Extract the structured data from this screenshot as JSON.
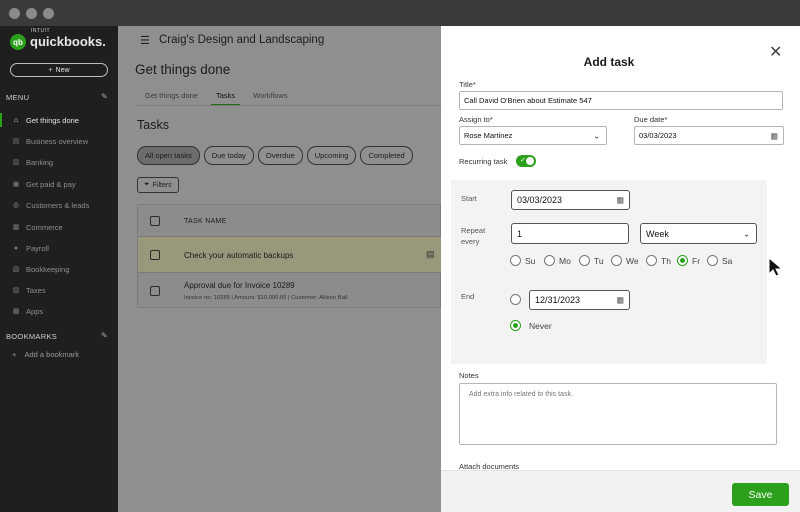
{
  "sidebar": {
    "logo_intuit": "INTUIT",
    "logo_text": "quickbooks.",
    "logo_mark": "qb",
    "new_label": "New",
    "menu_heading": "MENU",
    "items": [
      {
        "label": "Get things done",
        "icon": "house-icon"
      },
      {
        "label": "Business overview",
        "icon": "chart-icon"
      },
      {
        "label": "Banking",
        "icon": "bank-icon"
      },
      {
        "label": "Get paid & pay",
        "icon": "cash-icon"
      },
      {
        "label": "Customers & leads",
        "icon": "people-icon"
      },
      {
        "label": "Commerce",
        "icon": "cart-icon"
      },
      {
        "label": "Payroll",
        "icon": "person-icon"
      },
      {
        "label": "Bookkeeping",
        "icon": "ledger-icon"
      },
      {
        "label": "Taxes",
        "icon": "tax-icon"
      },
      {
        "label": "Apps",
        "icon": "apps-icon"
      }
    ],
    "bookmarks_heading": "BOOKMARKS",
    "add_bookmark": "Add a bookmark"
  },
  "main": {
    "company": "Craig's Design and Landscaping",
    "page_title": "Get things done",
    "tabs": [
      {
        "label": "Get things done"
      },
      {
        "label": "Tasks"
      },
      {
        "label": "Workflows"
      }
    ],
    "tasks_title": "Tasks",
    "chips": [
      {
        "label": "All open tasks"
      },
      {
        "label": "Due today"
      },
      {
        "label": "Overdue"
      },
      {
        "label": "Upcoming"
      },
      {
        "label": "Completed"
      }
    ],
    "filters_label": "Filters",
    "table": {
      "header": "TASK NAME",
      "rows": [
        {
          "title": "Check your automatic backups",
          "sub": ""
        },
        {
          "title": "Approval due for Invoice 10289",
          "sub": "Invoice no: 10289 | Amount: $10,000.00 | Customer: Allison Ball"
        }
      ]
    }
  },
  "drawer": {
    "title": "Add task",
    "title_label": "Title*",
    "title_value": "Call David O'Brien about Estimate 547",
    "assign_label": "Assign to*",
    "assign_value": "Rose Martinez",
    "due_label": "Due date*",
    "due_value": "03/03/2023",
    "recurring_label": "Recurring task",
    "recurring_on": true,
    "start_label": "Start",
    "start_value": "03/03/2023",
    "repeat_label_1": "Repeat",
    "repeat_label_2": "every",
    "repeat_value": "1",
    "repeat_unit": "Week",
    "days": [
      {
        "label": "Su",
        "selected": false
      },
      {
        "label": "Mo",
        "selected": false
      },
      {
        "label": "Tu",
        "selected": false
      },
      {
        "label": "We",
        "selected": false
      },
      {
        "label": "Th",
        "selected": false
      },
      {
        "label": "Fr",
        "selected": true
      },
      {
        "label": "Sa",
        "selected": false
      }
    ],
    "end_label": "End",
    "end_date_value": "12/31/2023",
    "never_label": "Never",
    "end_selection": "Never",
    "notes_label": "Notes",
    "notes_placeholder": "Add extra info related to this task.",
    "attach_label": "Attach documents",
    "save_label": "Save"
  },
  "colors": {
    "accent": "#2ca01c",
    "sidebar_bg": "#1f1f1f",
    "overlay_bg": "#8f8f8f"
  }
}
